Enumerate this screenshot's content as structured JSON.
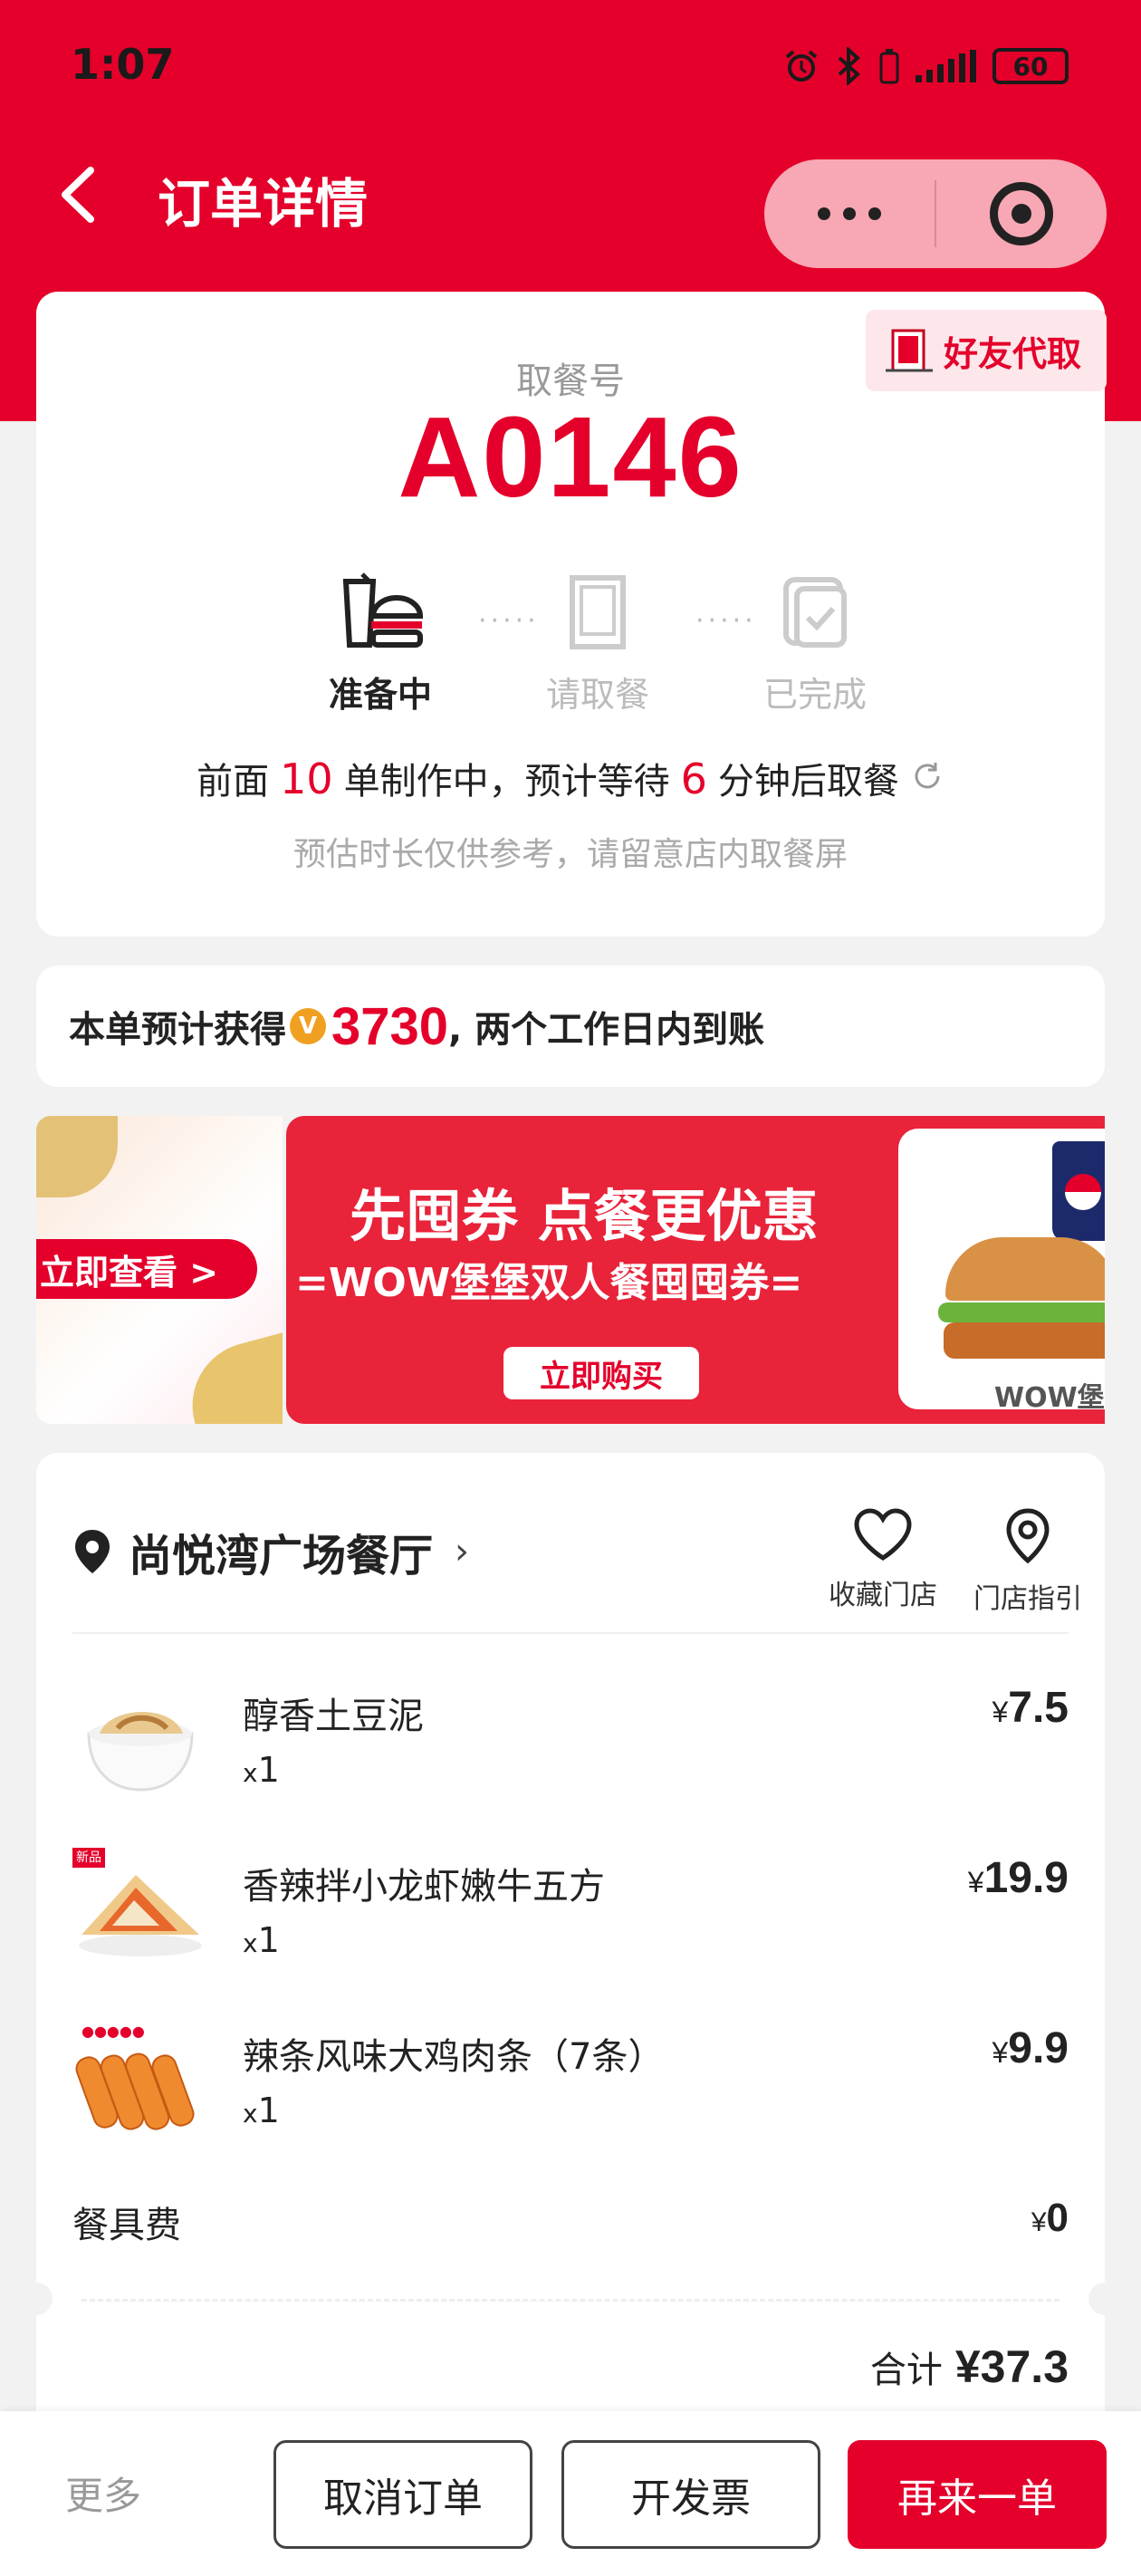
{
  "status_bar": {
    "time": "1:07",
    "battery": "60"
  },
  "nav": {
    "title": "订单详情"
  },
  "pickup": {
    "friend_button": "好友代取",
    "label": "取餐号",
    "number": "A0146",
    "steps": [
      {
        "label": "准备中",
        "state": "active"
      },
      {
        "label": "请取餐",
        "state": "pending"
      },
      {
        "label": "已完成",
        "state": "pending"
      }
    ],
    "queue": {
      "prefix": "前面",
      "orders_ahead": "10",
      "middle": "单制作中，预计等待",
      "wait_minutes": "6",
      "suffix": "分钟后取餐"
    },
    "note": "预估时长仅供参考，请留意店内取餐屏"
  },
  "points": {
    "prefix": "本单预计获得",
    "coin": "V",
    "value": "3730",
    "suffix": ", 两个工作日内到账"
  },
  "banner": {
    "left_cta": "立即查看 >",
    "headline": "先囤券 点餐更优惠",
    "subline": "=WOW堡堡双人餐囤囤券=",
    "buy_button": "立即购买",
    "product_label": "WOW堡"
  },
  "order": {
    "store_name": "尚悦湾广场餐厅",
    "actions": [
      {
        "label": "收藏门店",
        "icon": "heart-icon"
      },
      {
        "label": "门店指引",
        "icon": "location-pin-icon"
      }
    ],
    "items": [
      {
        "name": "醇香土豆泥",
        "qty": "1",
        "price": "7.5"
      },
      {
        "name": "香辣拌小龙虾嫩牛五方",
        "qty": "1",
        "price": "19.9",
        "badge": "新品"
      },
      {
        "name": "辣条风味大鸡肉条（7条）",
        "qty": "1",
        "price": "9.9"
      }
    ],
    "fee": {
      "label": "餐具费",
      "value": "0"
    },
    "total": {
      "label": "合计",
      "value": "¥37.3"
    },
    "currency": "¥",
    "qty_prefix": "x"
  },
  "bottom": {
    "more": "更多",
    "cancel": "取消订单",
    "invoice": "开发票",
    "reorder": "再来一单"
  },
  "colors": {
    "brand_red": "#e4002b",
    "background": "#f2f2f2"
  }
}
